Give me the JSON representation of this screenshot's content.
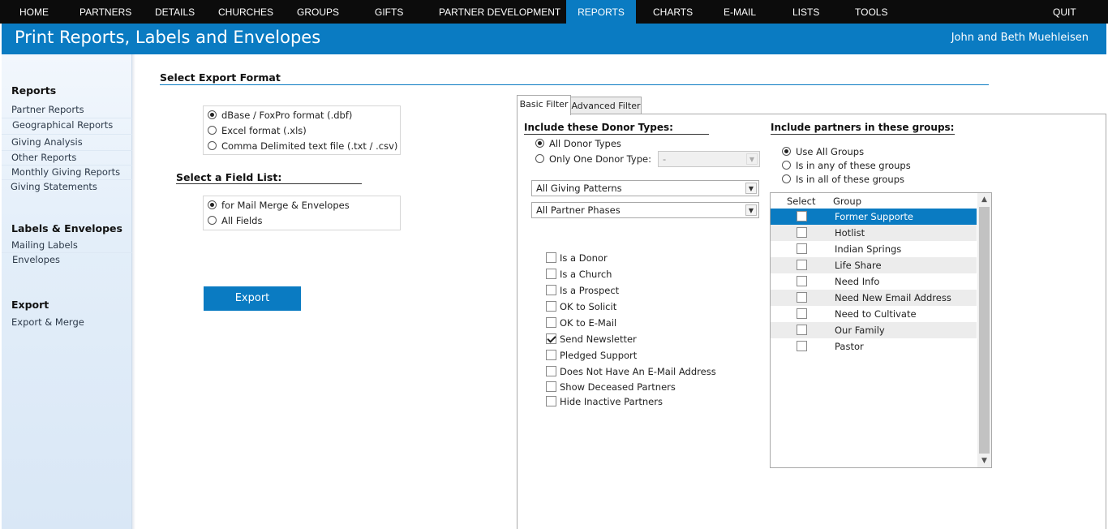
{
  "nav": {
    "items": [
      "HOME",
      "PARTNERS",
      "DETAILS",
      "CHURCHES",
      "GROUPS",
      "GIFTS",
      "PARTNER DEVELOPMENT",
      "REPORTS",
      "CHARTS",
      "E-MAIL",
      "LISTS",
      "TOOLS"
    ],
    "active": "REPORTS",
    "quit": "QUIT"
  },
  "header": {
    "title": "Print Reports, Labels and Envelopes",
    "user": "John and Beth Muehleisen"
  },
  "sidebar": {
    "reports_heading": "Reports",
    "reports": [
      "Partner Reports",
      "Geographical Reports",
      "Giving Analysis",
      "Other Reports",
      "Monthly Giving Reports",
      "Giving Statements"
    ],
    "labels_heading": "Labels & Envelopes",
    "labels": [
      "Mailing Labels",
      "Envelopes"
    ],
    "export_heading": "Export",
    "export": [
      "Export & Merge"
    ]
  },
  "export_format": {
    "title": "Select Export Format",
    "options": [
      "dBase / FoxPro format (.dbf)",
      "Excel  format (.xls)",
      "Comma Delimited text file (.txt / .csv)"
    ],
    "selected": 0
  },
  "field_list": {
    "title": "Select a Field List:",
    "options": [
      "for Mail Merge & Envelopes",
      "All Fields"
    ],
    "selected": 0
  },
  "export_button": "Export",
  "filter": {
    "tabs": [
      "Basic Filter",
      "Advanced Filter"
    ],
    "active_tab": "Basic Filter",
    "donor_types_heading": "Include these Donor Types:",
    "donor_type_options": [
      "All Donor Types",
      "Only One Donor Type:"
    ],
    "donor_type_selected": 0,
    "donor_type_value": "-",
    "giving_patterns": "All Giving Patterns",
    "partner_phases": "All Partner Phases",
    "checkboxes": [
      {
        "label": "Is a Donor",
        "checked": false
      },
      {
        "label": "Is a Church",
        "checked": false
      },
      {
        "label": "Is a Prospect",
        "checked": false
      },
      {
        "label": "OK to Solicit",
        "checked": false
      },
      {
        "label": "OK to E-Mail",
        "checked": false
      },
      {
        "label": "Send Newsletter",
        "checked": true
      },
      {
        "label": "Pledged Support",
        "checked": false
      },
      {
        "label": "Does Not Have An E-Mail Address",
        "checked": false
      },
      {
        "label": "Show Deceased Partners",
        "checked": false
      },
      {
        "label": "Hide Inactive Partners",
        "checked": false
      }
    ],
    "groups_heading": "Include partners in these groups:",
    "group_mode_options": [
      "Use All Groups",
      "Is in any of these groups",
      "Is in all of these groups"
    ],
    "group_mode_selected": 0,
    "groups_columns": [
      "Select",
      "Group"
    ],
    "groups": [
      {
        "name": "Former Supporte",
        "checked": false,
        "selected": true
      },
      {
        "name": "Hotlist",
        "checked": false,
        "selected": false
      },
      {
        "name": "Indian Springs",
        "checked": false,
        "selected": false
      },
      {
        "name": "Life Share",
        "checked": false,
        "selected": false
      },
      {
        "name": "Need Info",
        "checked": false,
        "selected": false
      },
      {
        "name": "Need New Email Address",
        "checked": false,
        "selected": false
      },
      {
        "name": "Need to Cultivate",
        "checked": false,
        "selected": false
      },
      {
        "name": "Our Family",
        "checked": false,
        "selected": false
      },
      {
        "name": "Pastor",
        "checked": false,
        "selected": false
      }
    ]
  },
  "colors": {
    "accent": "#0a7bc2",
    "nav_bg": "#0c0c0c"
  }
}
